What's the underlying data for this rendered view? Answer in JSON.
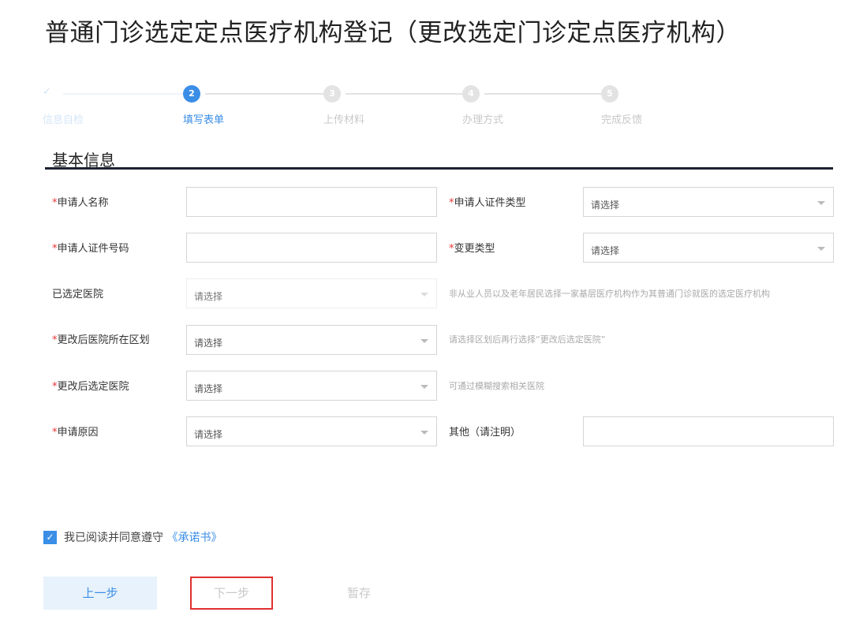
{
  "title": "普通门诊选定定点医疗机构登记（更改选定门诊定点医疗机构）",
  "steps": [
    {
      "label": "信息自检",
      "num": "✓"
    },
    {
      "label": "填写表单",
      "num": "2"
    },
    {
      "label": "上传材料",
      "num": "3"
    },
    {
      "label": "办理方式",
      "num": "4"
    },
    {
      "label": "完成反馈",
      "num": "5"
    }
  ],
  "section": "基本信息",
  "fields": {
    "applicant_name": {
      "label": "申请人名称",
      "value": ""
    },
    "id_type": {
      "label": "申请人证件类型",
      "value": "请选择"
    },
    "id_number": {
      "label": "申请人证件号码",
      "value": ""
    },
    "change_type": {
      "label": "变更类型",
      "value": "请选择"
    },
    "selected_hospital": {
      "label": "已选定医院",
      "value": "请选择",
      "hint": "非从业人员以及老年居民选择一家基层医疗机构作为其普通门诊就医的选定医疗机构"
    },
    "new_district": {
      "label": "更改后医院所在区划",
      "value": "请选择",
      "hint": "请选择区划后再行选择“更改后选定医院”"
    },
    "new_hospital": {
      "label": "更改后选定医院",
      "value": "请选择",
      "hint": "可通过模糊搜索相关医院"
    },
    "reason": {
      "label": "申请原因",
      "value": "请选择"
    },
    "other": {
      "label": "其他（请注明）",
      "value": ""
    }
  },
  "required_mark": "*",
  "agreement": {
    "text": "我已阅读并同意遵守",
    "link": "《承诺书》",
    "checked": true
  },
  "buttons": {
    "prev": "上一步",
    "next": "下一步",
    "save": "暂存"
  }
}
